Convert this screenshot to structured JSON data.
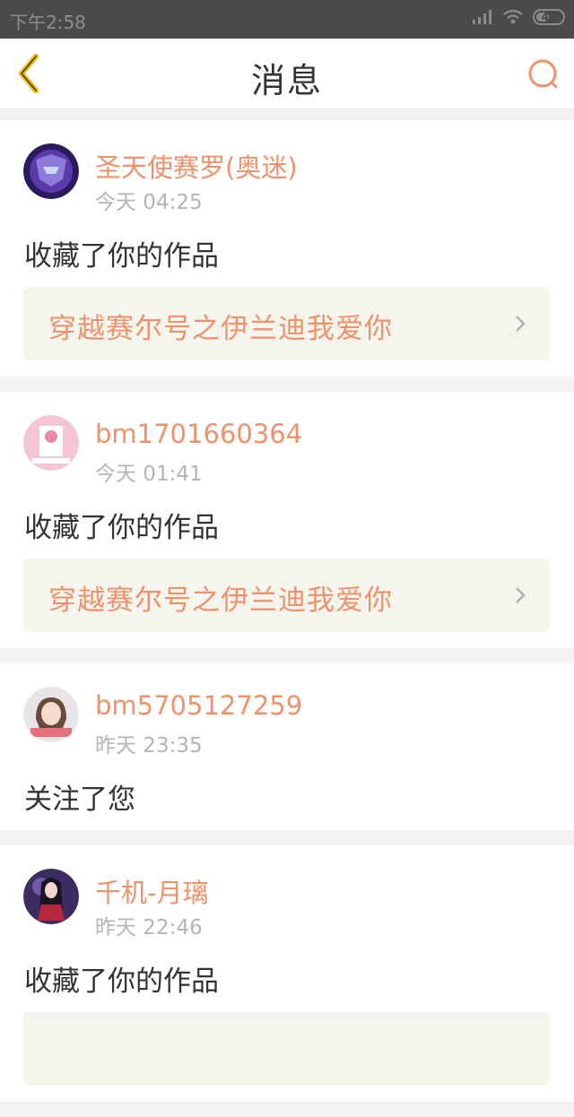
{
  "status_bar": {
    "time": "下午2:58",
    "battery": "47"
  },
  "nav": {
    "title": "消息"
  },
  "messages": [
    {
      "user": "圣天使赛罗(奥迷)",
      "time": "今天 04:25",
      "action": "收藏了你的作品",
      "work": "穿越赛尔号之伊兰迪我爱你"
    },
    {
      "user": "bm1701660364",
      "time": "今天 01:41",
      "action": "收藏了你的作品",
      "work": "穿越赛尔号之伊兰迪我爱你"
    },
    {
      "user": "bm5705127259",
      "time": "昨天 23:35",
      "action": "关注了您"
    },
    {
      "user": "千机-月璃",
      "time": "昨天 22:46",
      "action": "收藏了你的作品"
    }
  ],
  "colors": {
    "accent": "#f0916a",
    "status_bar": "#4a4a4a",
    "link_bg": "#f5f5ee",
    "page_bg": "#f2f2f2"
  }
}
